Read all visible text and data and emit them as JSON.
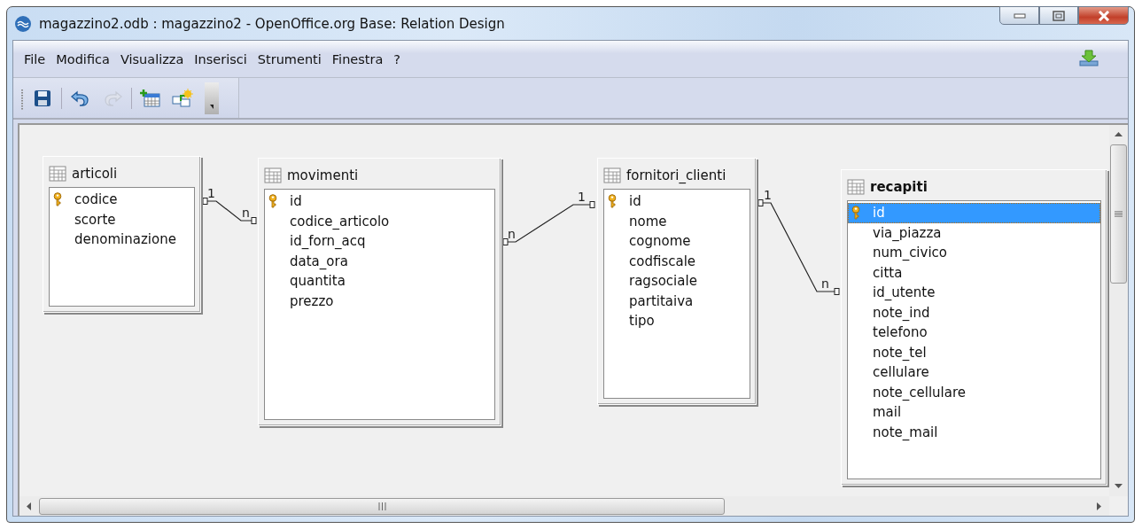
{
  "window": {
    "title": "magazzino2.odb : magazzino2 - OpenOffice.org Base: Relation Design"
  },
  "menu": [
    "File",
    "Modifica",
    "Visualizza",
    "Inserisci",
    "Strumenti",
    "Finestra",
    "?"
  ],
  "toolbar": [
    {
      "kind": "save",
      "disabled": false
    },
    {
      "kind": "undo",
      "disabled": false
    },
    {
      "kind": "redo",
      "disabled": true
    },
    {
      "kind": "add-table",
      "disabled": false
    },
    {
      "kind": "new-relation",
      "disabled": false
    }
  ],
  "tables": [
    {
      "name": "articoli",
      "active": false,
      "fields": [
        {
          "name": "codice",
          "key": true,
          "selected": false
        },
        {
          "name": "scorte",
          "key": false,
          "selected": false
        },
        {
          "name": "denominazione",
          "key": false,
          "selected": false
        }
      ]
    },
    {
      "name": "movimenti",
      "active": false,
      "fields": [
        {
          "name": "id",
          "key": true,
          "selected": false
        },
        {
          "name": "codice_articolo",
          "key": false,
          "selected": false
        },
        {
          "name": "id_forn_acq",
          "key": false,
          "selected": false
        },
        {
          "name": "data_ora",
          "key": false,
          "selected": false
        },
        {
          "name": "quantita",
          "key": false,
          "selected": false
        },
        {
          "name": "prezzo",
          "key": false,
          "selected": false
        }
      ]
    },
    {
      "name": "fornitori_clienti",
      "active": false,
      "fields": [
        {
          "name": "id",
          "key": true,
          "selected": false
        },
        {
          "name": "nome",
          "key": false,
          "selected": false
        },
        {
          "name": "cognome",
          "key": false,
          "selected": false
        },
        {
          "name": "codfiscale",
          "key": false,
          "selected": false
        },
        {
          "name": "ragsociale",
          "key": false,
          "selected": false
        },
        {
          "name": "partitaiva",
          "key": false,
          "selected": false
        },
        {
          "name": "tipo",
          "key": false,
          "selected": false
        }
      ]
    },
    {
      "name": "recapiti",
      "active": true,
      "fields": [
        {
          "name": "id",
          "key": true,
          "selected": true
        },
        {
          "name": "via_piazza",
          "key": false,
          "selected": false
        },
        {
          "name": "num_civico",
          "key": false,
          "selected": false
        },
        {
          "name": "citta",
          "key": false,
          "selected": false
        },
        {
          "name": "id_utente",
          "key": false,
          "selected": false
        },
        {
          "name": "note_ind",
          "key": false,
          "selected": false
        },
        {
          "name": "telefono",
          "key": false,
          "selected": false
        },
        {
          "name": "note_tel",
          "key": false,
          "selected": false
        },
        {
          "name": "cellulare",
          "key": false,
          "selected": false
        },
        {
          "name": "note_cellulare",
          "key": false,
          "selected": false
        },
        {
          "name": "mail",
          "key": false,
          "selected": false
        },
        {
          "name": "note_mail",
          "key": false,
          "selected": false
        }
      ]
    }
  ],
  "relations": [
    {
      "from_label": "1",
      "to_label": "n"
    },
    {
      "from_label": "n",
      "to_label": "1"
    },
    {
      "from_label": "1",
      "to_label": "n"
    }
  ]
}
